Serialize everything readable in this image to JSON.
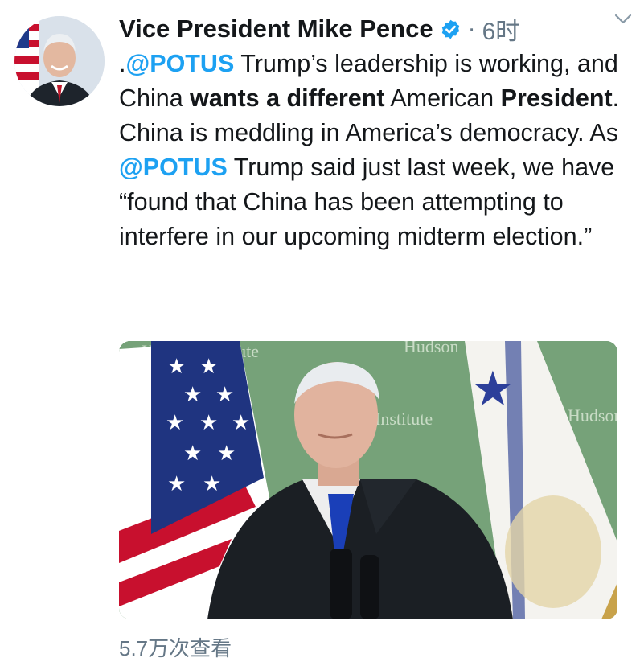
{
  "author": {
    "name": "Vice President Mike Pence",
    "verified_icon": "verified-badge-icon",
    "separator": "·",
    "time": "6时"
  },
  "tweet": {
    "segments": [
      {
        "text": ".",
        "style": "normal"
      },
      {
        "text": "@POTUS",
        "style": "mention"
      },
      {
        "text": " Trump’s leadership is working, and China ",
        "style": "normal"
      },
      {
        "text": "wants a different",
        "style": "bold"
      },
      {
        "text": " American ",
        "style": "normal"
      },
      {
        "text": "President",
        "style": "bold"
      },
      {
        "text": ". China is meddling in America’s democracy. As ",
        "style": "normal"
      },
      {
        "text": "@POTUS",
        "style": "mention"
      },
      {
        "text": " Trump said just last week, we have “found that China has been attempting to interfere in our upcoming midterm election.”",
        "style": "normal"
      }
    ]
  },
  "media": {
    "backdrop_texts": [
      "Hudson Institute",
      "Hudson",
      "Institute",
      "Hudson"
    ],
    "colors": {
      "backdrop": "#6f9a72",
      "suit": "#1b1f24",
      "tie": "#1a3fb8"
    }
  },
  "footer": {
    "views": "5.7万次查看"
  },
  "colors": {
    "text": "#14171a",
    "secondary": "#657786",
    "accent": "#1da1f2"
  }
}
